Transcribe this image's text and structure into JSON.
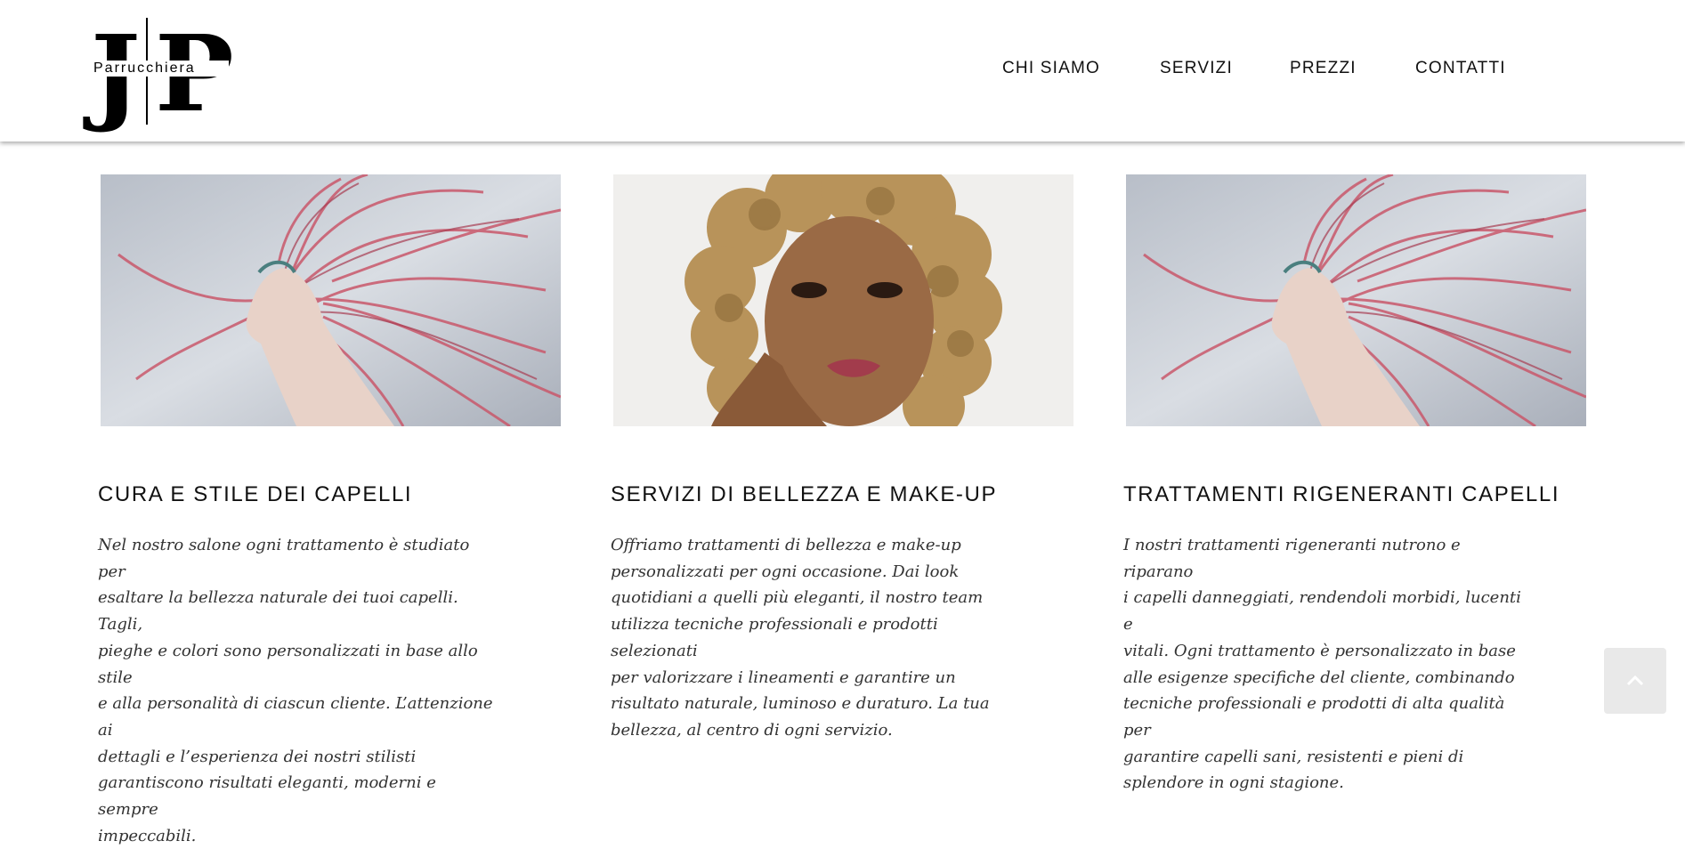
{
  "brand": {
    "logo_j": "J",
    "logo_p": "P",
    "logo_word": "Parrucchiera"
  },
  "nav": {
    "items": [
      {
        "label": "CHI SIAMO"
      },
      {
        "label": "SERVIZI"
      },
      {
        "label": "PREZZI"
      },
      {
        "label": "CONTATTI"
      }
    ]
  },
  "cards": [
    {
      "title": "CURA E STILE DEI CAPELLI",
      "image": "woman-pink-hair-photo",
      "lines": [
        "Nel nostro salone ogni trattamento è studiato per",
        "esaltare la bellezza naturale dei tuoi capelli. Tagli,",
        "pieghe e colori sono personalizzati in base allo stile",
        "e alla personalità di ciascun cliente. L’attenzione ai",
        "dettagli e l’esperienza dei nostri stilisti",
        "garantiscono risultati eleganti, moderni e sempre",
        "impeccabili."
      ]
    },
    {
      "title": "SERVIZI DI BELLEZZA E MAKE-UP",
      "image": "woman-curly-blonde-hair-photo",
      "lines": [
        "Offriamo trattamenti di bellezza e make-up",
        "personalizzati per ogni occasione. Dai look",
        "quotidiani a quelli più eleganti, il nostro team",
        "utilizza tecniche professionali e prodotti selezionati",
        "per valorizzare i lineamenti e garantire un",
        "risultato naturale, luminoso e duraturo. La tua",
        "bellezza, al centro di ogni servizio."
      ]
    },
    {
      "title": "TRATTAMENTI RIGENERANTI CAPELLI",
      "image": "woman-pink-hair-photo",
      "lines": [
        "I nostri trattamenti rigeneranti nutrono e riparano",
        "i capelli danneggiati, rendendoli morbidi, lucenti e",
        "vitali. Ogni trattamento è personalizzato in base",
        "alle esigenze specifiche del cliente, combinando",
        "tecniche professionali e prodotti di alta qualità per",
        "garantire capelli sani, resistenti e pieni di",
        "splendore in ogni stagione."
      ]
    }
  ],
  "scroll_top": {
    "icon": "chevron-up-icon"
  },
  "colors": {
    "pink_hair": "#c9586b",
    "blonde_hair": "#b8935a",
    "background": "#ffffff"
  }
}
